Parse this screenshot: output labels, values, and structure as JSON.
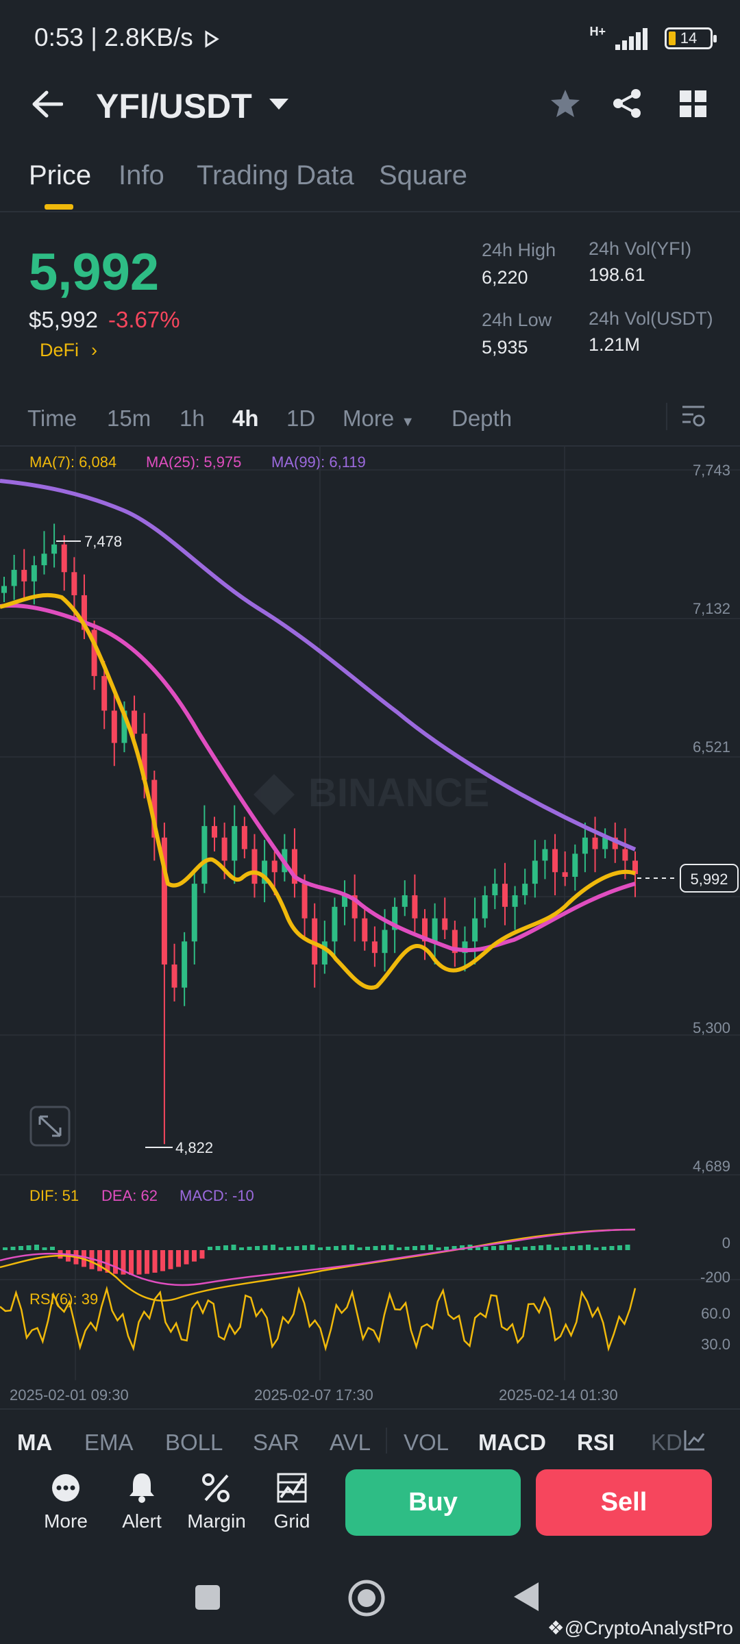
{
  "status_bar": {
    "time_net": "0:53 | 2.8KB/s",
    "network": "H+",
    "battery": "14"
  },
  "header": {
    "pair": "YFI/USDT"
  },
  "tabs": [
    "Price",
    "Info",
    "Trading Data",
    "Square"
  ],
  "price": {
    "last": "5,992",
    "usd": "$5,992",
    "change": "-3.67%",
    "tag": "DeFi",
    "high_label": "24h High",
    "high": "6,220",
    "low_label": "24h Low",
    "low": "5,935",
    "vol_yfi_label": "24h Vol(YFI)",
    "vol_yfi": "198.61",
    "vol_usdt_label": "24h Vol(USDT)",
    "vol_usdt": "1.21M"
  },
  "intervals": [
    "Time",
    "15m",
    "1h",
    "4h",
    "1D",
    "More",
    "Depth"
  ],
  "ma_legend": {
    "ma7": "MA(7): 6,084",
    "ma25": "MA(25): 5,975",
    "ma99": "MA(99): 6,119"
  },
  "macd_legend": {
    "dif": "DIF: 51",
    "dea": "DEA: 62",
    "macd": "MACD: -10"
  },
  "rsi_legend": "RSI(6): 39",
  "watermark_brand": "BINANCE",
  "colors": {
    "up": "#2ebd85",
    "down": "#f6465d",
    "ma7": "#f0b90b",
    "ma25": "#e04ec0",
    "ma99": "#9c6ade",
    "bg": "#1e2329"
  },
  "indicator_tabs": [
    "MA",
    "EMA",
    "BOLL",
    "SAR",
    "AVL",
    "VOL",
    "MACD",
    "RSI",
    "KD"
  ],
  "bottom_actions": [
    "More",
    "Alert",
    "Margin",
    "Grid"
  ],
  "buy": "Buy",
  "sell": "Sell",
  "credit": "@CryptoAnalystPro",
  "chart_data": {
    "type": "candlestick",
    "price_axis_ticks": [
      "7,743",
      "7,132",
      "6,521",
      "5,300",
      "4,689"
    ],
    "price_tag": "5,992",
    "high_marker": "7,478",
    "low_marker": "4,822",
    "macd_axis_ticks": [
      "0",
      "-200"
    ],
    "rsi_axis_ticks": [
      "60.0",
      "30.0"
    ],
    "time_labels": [
      "2025-02-01 09:30",
      "2025-02-07 17:30",
      "2025-02-14 01:30"
    ],
    "ylim": [
      4689,
      7743
    ],
    "closes": [
      7240,
      7310,
      7260,
      7330,
      7380,
      7420,
      7300,
      7200,
      7050,
      6850,
      6700,
      6560,
      6700,
      6600,
      6400,
      6150,
      5600,
      5500,
      5700,
      5950,
      6200,
      6150,
      6050,
      6200,
      6100,
      5950,
      6050,
      6000,
      6100,
      5950,
      5800,
      5600,
      5700,
      5850,
      5900,
      5800,
      5700,
      5650,
      5750,
      5850,
      5900,
      5800,
      5700,
      5800,
      5750,
      5650,
      5700,
      5800,
      5900,
      5950,
      5850,
      5900,
      5950,
      6050,
      6100,
      6000,
      5980,
      6080,
      6150,
      6100,
      6150,
      6100,
      6050,
      5992
    ],
    "ma99": [
      7650,
      7620,
      7590,
      7560,
      7520,
      7470,
      7420,
      7360,
      7290,
      7220,
      7150,
      7080,
      7010,
      6940,
      6870,
      6800,
      6730,
      6660,
      6590,
      6520,
      6450,
      6390,
      6330,
      6280,
      6230,
      6180,
      6150,
      6119
    ]
  }
}
